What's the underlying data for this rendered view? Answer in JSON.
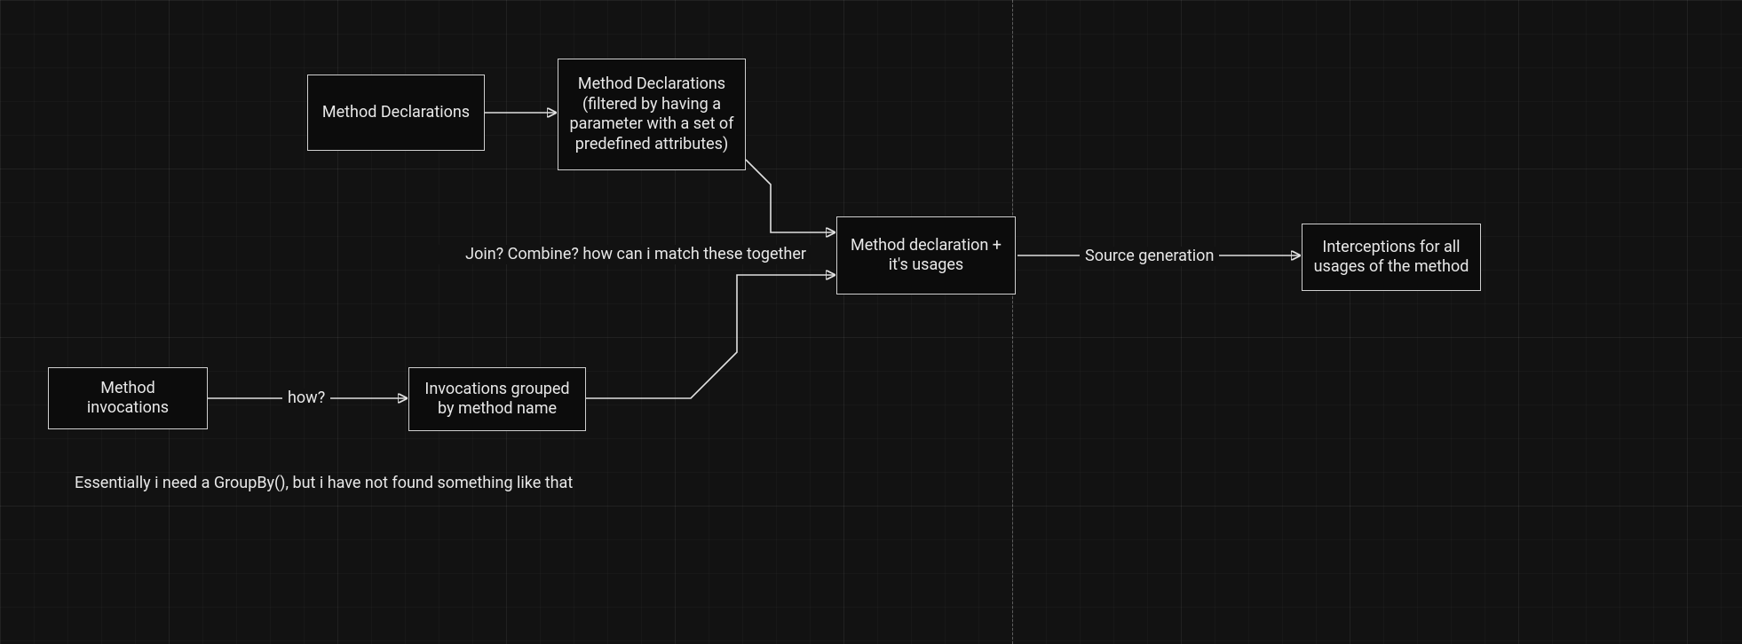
{
  "nodes": {
    "method_declarations": {
      "text": "Method Declarations"
    },
    "filtered_declarations": {
      "text": "Method Declarations (filtered by having a parameter with a set of predefined attributes)"
    },
    "method_invocations": {
      "text": "Method invocations"
    },
    "invocations_grouped": {
      "text": "Invocations grouped by method name"
    },
    "combined": {
      "text": "Method declaration + it's usages"
    },
    "interceptions": {
      "text": "Interceptions for all usages of the method"
    }
  },
  "edge_labels": {
    "how": "how?",
    "join_combine": "Join? Combine? how can i match these together",
    "source_generation": "Source generation"
  },
  "notes": {
    "groupby": "Essentially i need a GroupBy(), but i have not found something like that"
  }
}
